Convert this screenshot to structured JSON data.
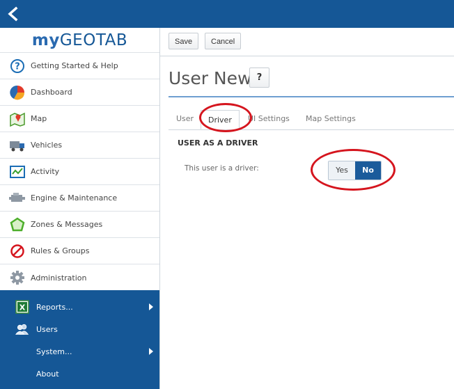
{
  "colors": {
    "brand": "#155796",
    "accent_active": "#1b5b9b",
    "annotation": "#d5151e"
  },
  "logo": {
    "prefix": "my",
    "brand": "GEOTAB"
  },
  "sidebar": {
    "items": [
      {
        "label": "Getting Started & Help",
        "icon": "help-icon"
      },
      {
        "label": "Dashboard",
        "icon": "pie-chart-icon"
      },
      {
        "label": "Map",
        "icon": "map-icon"
      },
      {
        "label": "Vehicles",
        "icon": "truck-icon"
      },
      {
        "label": "Activity",
        "icon": "activity-chart-icon"
      },
      {
        "label": "Engine & Maintenance",
        "icon": "engine-icon"
      },
      {
        "label": "Zones & Messages",
        "icon": "zone-icon"
      },
      {
        "label": "Rules & Groups",
        "icon": "prohibited-icon"
      },
      {
        "label": "Administration",
        "icon": "gear-icon"
      }
    ],
    "sub_items": [
      {
        "label": "Reports...",
        "icon": "excel-icon",
        "has_arrow": true
      },
      {
        "label": "Users",
        "icon": "users-icon",
        "has_arrow": false
      },
      {
        "label": "System...",
        "has_arrow": true
      },
      {
        "label": "About",
        "has_arrow": false
      }
    ]
  },
  "toolbar": {
    "save_label": "Save",
    "cancel_label": "Cancel"
  },
  "page": {
    "title": "User New",
    "help_label": "?"
  },
  "tabs": [
    {
      "label": "User",
      "active": false
    },
    {
      "label": "Driver",
      "active": true
    },
    {
      "label": "UI Settings",
      "active": false
    },
    {
      "label": "Map Settings",
      "active": false
    }
  ],
  "driver": {
    "section_title": "USER AS A DRIVER",
    "field_label": "This user is a driver:",
    "yes_label": "Yes",
    "no_label": "No",
    "selected": "No"
  }
}
